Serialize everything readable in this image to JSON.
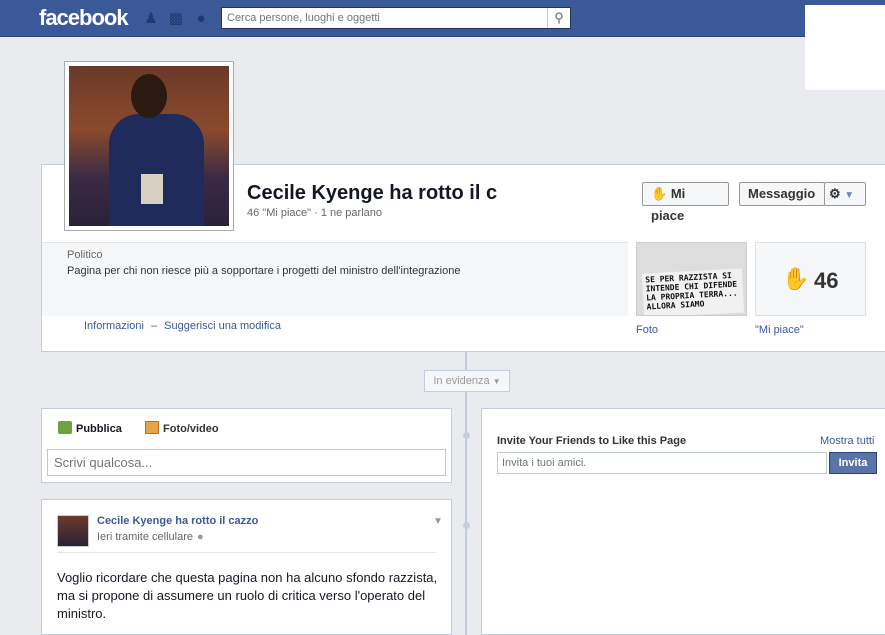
{
  "topbar": {
    "logo": "facebook",
    "search_placeholder": "Cerca persone, luoghi e oggetti"
  },
  "page": {
    "title": "Cecile Kyenge ha rotto il c",
    "stats": "46 \"Mi piace\" · 1 ne parlano",
    "like_button": "Mi piace",
    "message_button": "Messaggio",
    "category": "Politico",
    "about": "Pagina per chi non riesce più a sopportare i progetti del ministro dell'integrazione",
    "link_info": "Informazioni",
    "link_separator": "–",
    "link_suggest": "Suggerisci una modifica",
    "photos_label": "Foto",
    "likes_label": "\"Mi piace\"",
    "likes_count": "46",
    "photo_sign_text": "SE PER RAZZISTA SI INTENDE CHI DIFENDE LA PROPRIA TERRA... ALLORA SIAMO"
  },
  "timeline": {
    "highlight_label": "In evidenza"
  },
  "composer": {
    "tab_publish": "Pubblica",
    "tab_photo": "Foto/video",
    "placeholder": "Scrivi qualcosa..."
  },
  "invite": {
    "title": "Invite Your Friends to Like this Page",
    "show_all": "Mostra tutti",
    "placeholder": "Invita i tuoi amici.",
    "button": "Invita"
  },
  "post": {
    "author": "Cecile Kyenge ha rotto il cazzo",
    "meta": "Ieri tramite cellulare",
    "text": "Voglio ricordare che questa pagina non ha alcuno sfondo razzista, ma si propone di assumere un ruolo di critica verso l'operato del ministro."
  },
  "colors": {
    "brand": "#3b5998",
    "background": "#e9ebee",
    "border": "#c4cde0"
  },
  "icons": {
    "friends": "friends-icon",
    "messages": "messages-icon",
    "notifications": "globe-icon",
    "search": "search-icon",
    "thumbs_up": "thumbs-up-icon",
    "gear": "gear-icon"
  }
}
